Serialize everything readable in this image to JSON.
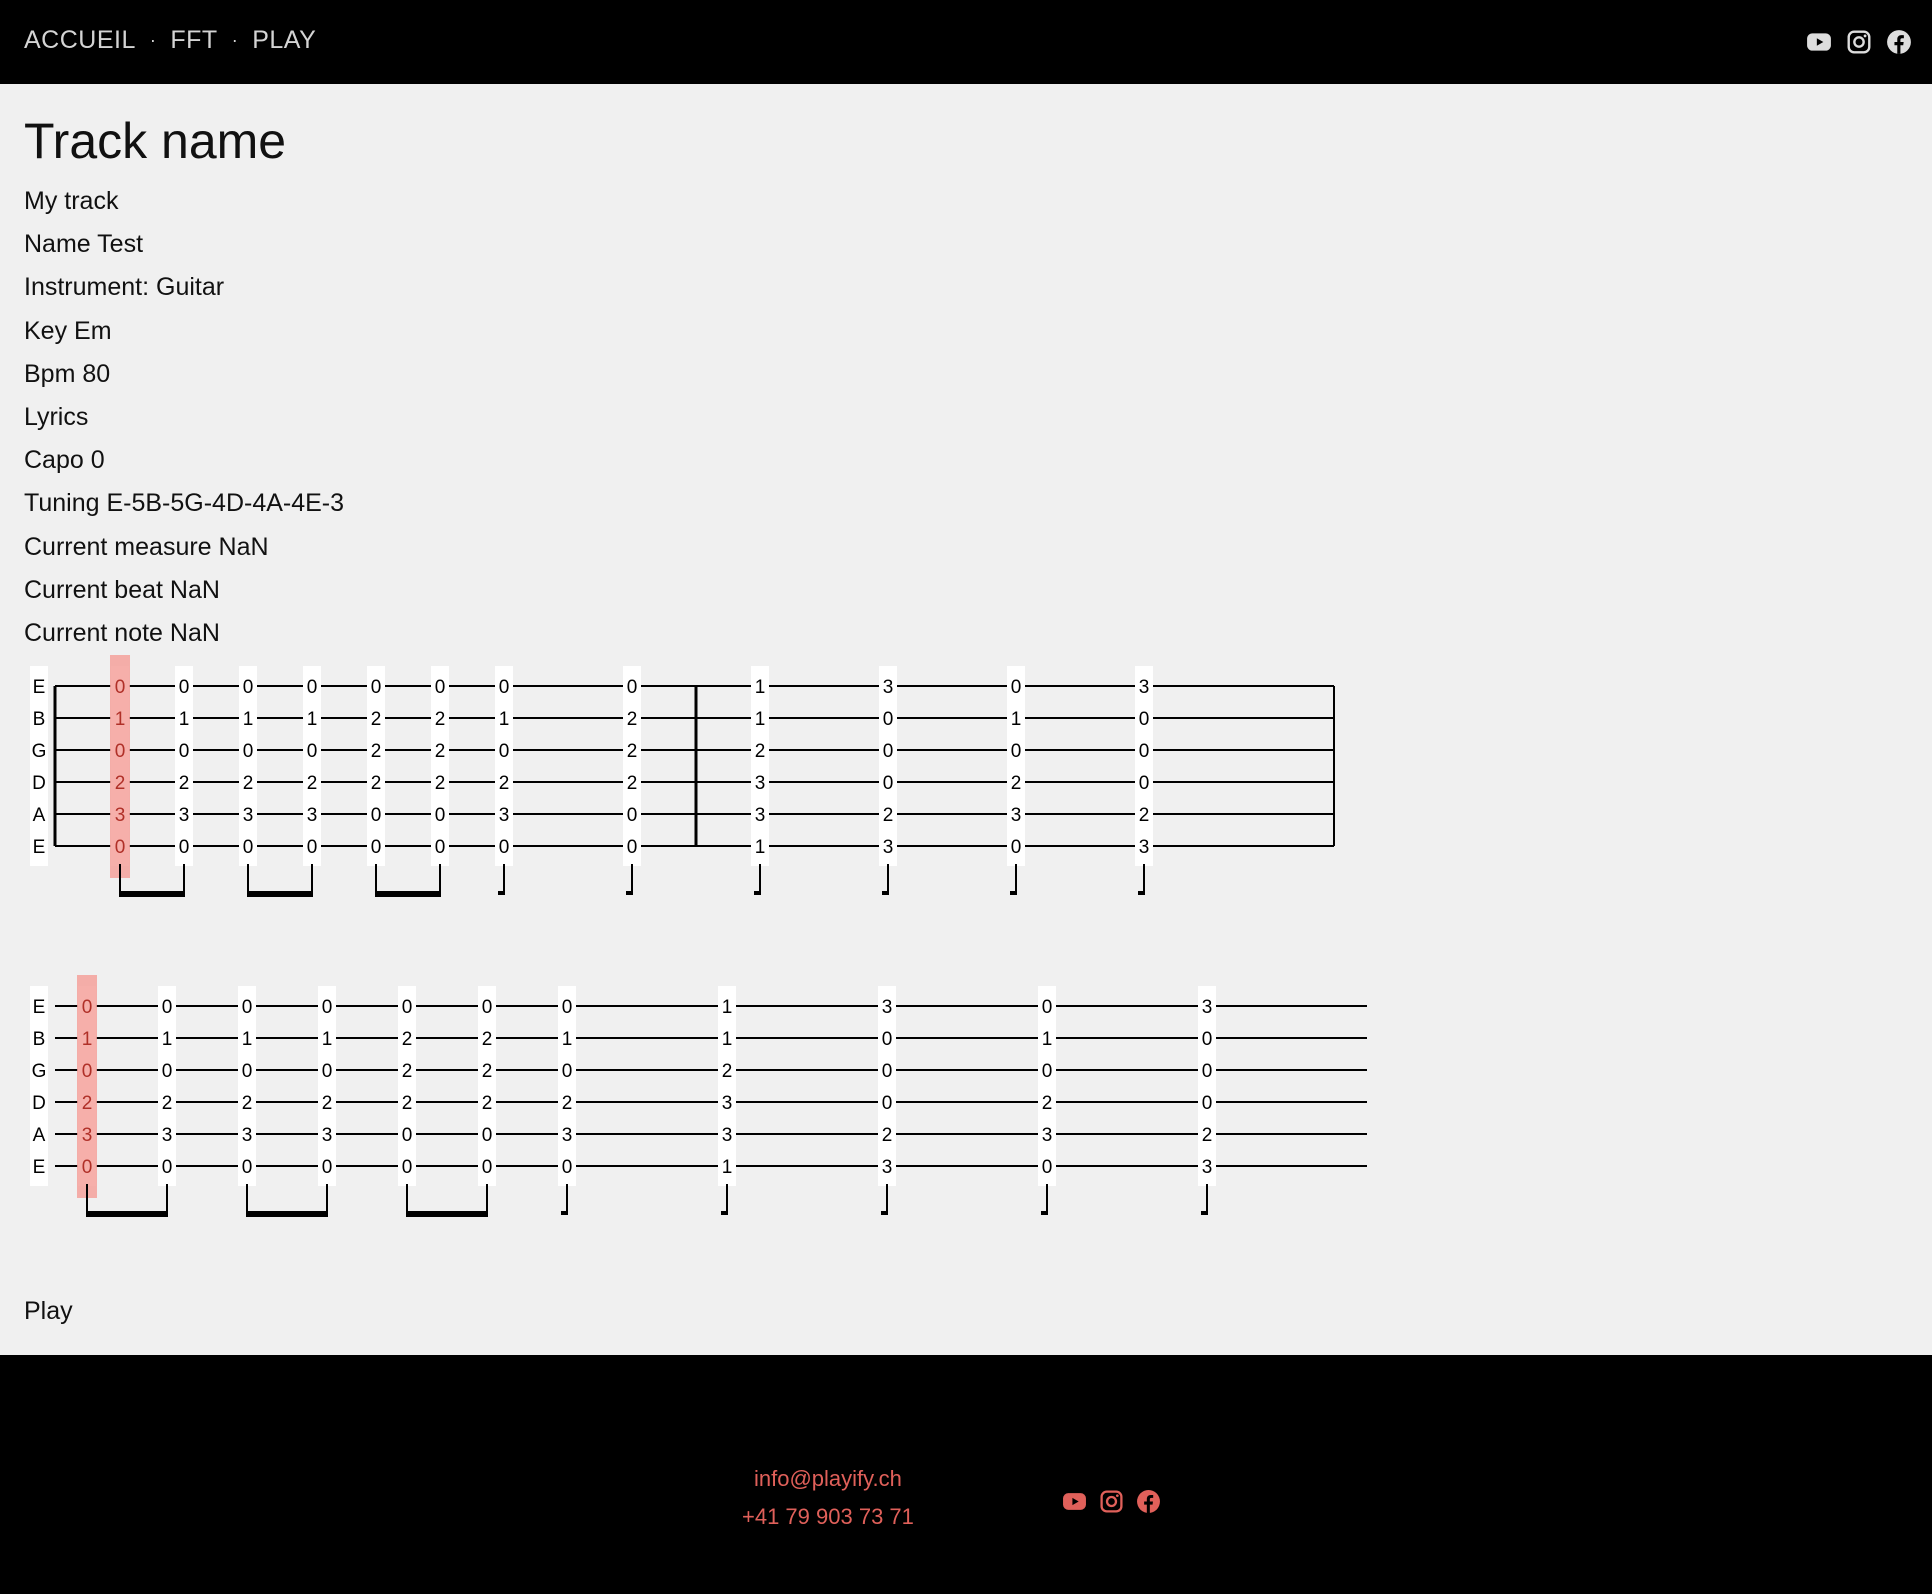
{
  "header": {
    "nav": [
      {
        "label": "ACCUEIL"
      },
      {
        "label": "FFT"
      },
      {
        "label": "PLAY"
      }
    ],
    "separator": "·",
    "social_icons": [
      "youtube-icon",
      "instagram-icon",
      "facebook-icon"
    ]
  },
  "track": {
    "heading": "Track name",
    "lines": [
      "My track",
      "Name Test",
      "Instrument: Guitar",
      "Key Em",
      "Bpm 80",
      "Lyrics",
      "Capo 0",
      "Tuning E-5B-5G-4D-4A-4E-3",
      "Current measure NaN",
      "Current beat NaN",
      "Current note NaN"
    ]
  },
  "tablature": {
    "string_labels": [
      "E",
      "B",
      "G",
      "D",
      "A",
      "E"
    ],
    "highlight_color": "#f4a19b",
    "staves": [
      {
        "highlighted_beat": 0,
        "beats": [
          {
            "frets": [
              0,
              1,
              0,
              2,
              3,
              0
            ],
            "duration": "eighth"
          },
          {
            "frets": [
              0,
              1,
              0,
              2,
              3,
              0
            ],
            "duration": "eighth"
          },
          {
            "frets": [
              0,
              1,
              0,
              2,
              3,
              0
            ],
            "duration": "eighth"
          },
          {
            "frets": [
              0,
              1,
              0,
              2,
              3,
              0
            ],
            "duration": "eighth"
          },
          {
            "frets": [
              0,
              2,
              2,
              2,
              0,
              0
            ],
            "duration": "eighth"
          },
          {
            "frets": [
              0,
              2,
              2,
              2,
              0,
              0
            ],
            "duration": "eighth"
          },
          {
            "frets": [
              0,
              1,
              0,
              2,
              3,
              0
            ],
            "duration": "quarter"
          },
          {
            "frets": [
              0,
              2,
              2,
              2,
              0,
              0
            ],
            "duration": "quarter",
            "barline_after": true
          },
          {
            "frets": [
              1,
              1,
              2,
              3,
              3,
              1
            ],
            "duration": "quarter"
          },
          {
            "frets": [
              3,
              0,
              0,
              0,
              2,
              3
            ],
            "duration": "quarter"
          },
          {
            "frets": [
              0,
              1,
              0,
              2,
              3,
              0
            ],
            "duration": "quarter"
          },
          {
            "frets": [
              3,
              0,
              0,
              0,
              2,
              3
            ],
            "duration": "quarter"
          }
        ]
      },
      {
        "highlighted_beat": 0,
        "beats": [
          {
            "frets": [
              0,
              1,
              0,
              2,
              3,
              0
            ],
            "duration": "eighth"
          },
          {
            "frets": [
              0,
              1,
              0,
              2,
              3,
              0
            ],
            "duration": "eighth"
          },
          {
            "frets": [
              0,
              1,
              0,
              2,
              3,
              0
            ],
            "duration": "eighth"
          },
          {
            "frets": [
              0,
              1,
              0,
              2,
              3,
              0
            ],
            "duration": "eighth"
          },
          {
            "frets": [
              0,
              2,
              2,
              2,
              0,
              0
            ],
            "duration": "eighth"
          },
          {
            "frets": [
              0,
              2,
              2,
              2,
              0,
              0
            ],
            "duration": "eighth"
          },
          {
            "frets": [
              0,
              1,
              0,
              2,
              3,
              0
            ],
            "duration": "quarter"
          },
          {
            "frets": [
              1,
              1,
              2,
              3,
              3,
              1
            ],
            "duration": "quarter"
          },
          {
            "frets": [
              3,
              0,
              0,
              0,
              2,
              3
            ],
            "duration": "quarter"
          },
          {
            "frets": [
              0,
              1,
              0,
              2,
              3,
              0
            ],
            "duration": "quarter"
          },
          {
            "frets": [
              3,
              0,
              0,
              0,
              2,
              3
            ],
            "duration": "quarter"
          }
        ]
      }
    ]
  },
  "play_label": "Play",
  "footer": {
    "email": "info@playify.ch",
    "phone": "+41 79 903 73 71",
    "accent_color": "#e0605a",
    "social_icons": [
      "youtube-icon",
      "instagram-icon",
      "facebook-icon"
    ]
  }
}
